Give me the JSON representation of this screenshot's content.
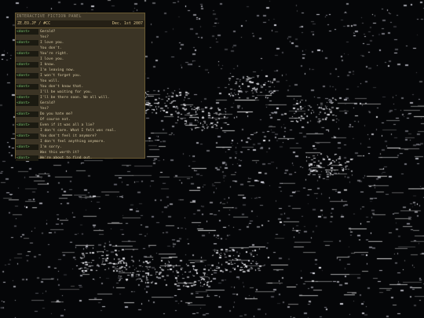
{
  "panel": {
    "title": "INTERACTIVE FICTION PANEL",
    "header_left": "ZE.EO.JF / #CC",
    "header_right": "Dec. 1st 2007"
  },
  "log": [
    {
      "who": "<dont>",
      "text": "Gerald?"
    },
    {
      "who": "",
      "text": "Yes?"
    },
    {
      "who": "<dont>",
      "text": "I love you."
    },
    {
      "who": "",
      "text": "You don't."
    },
    {
      "who": "<dont>",
      "text": "You're right."
    },
    {
      "who": "",
      "text": "I love you."
    },
    {
      "who": "<dont>",
      "text": "I know."
    },
    {
      "who": "",
      "text": "I'm leaving now."
    },
    {
      "who": "<dont>",
      "text": "I won't forget you."
    },
    {
      "who": "",
      "text": "You will."
    },
    {
      "who": "<dont>",
      "text": "You don't know that."
    },
    {
      "who": "",
      "text": "I'll be waiting for you."
    },
    {
      "who": "<dont>",
      "text": "I'll be there soon. We all will."
    },
    {
      "who": "<dont>",
      "text": "Gerald?"
    },
    {
      "who": "",
      "text": "Yes?"
    },
    {
      "who": "<dont>",
      "text": "Do you hate me?"
    },
    {
      "who": "",
      "text": "Of course not."
    },
    {
      "who": "<dont>",
      "text": "Even if it was all a lie?"
    },
    {
      "who": "",
      "text": "I don't care. What I felt was real."
    },
    {
      "who": "<dont>",
      "text": "You don't feel it anymore?"
    },
    {
      "who": "",
      "text": "I don't feel anything anymore."
    },
    {
      "who": "<dont>",
      "text": "I'm sorry."
    },
    {
      "who": "",
      "text": "Was this worth it?"
    },
    {
      "who": "<dont>",
      "text": "We're about to find out."
    }
  ],
  "colors": {
    "panel_bg": "#3b3425",
    "nick": "#76c16c",
    "text": "#d4c7a3",
    "background": "#050608"
  }
}
